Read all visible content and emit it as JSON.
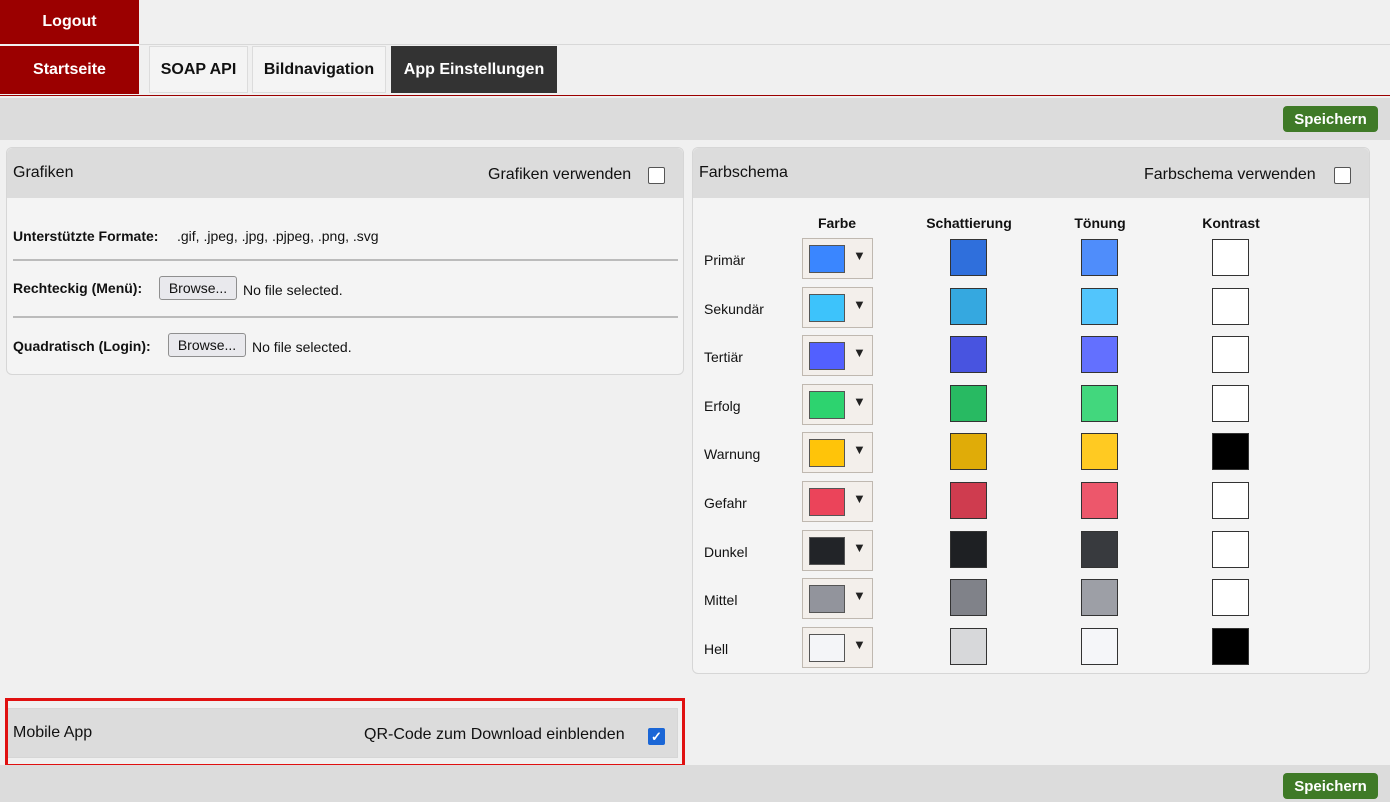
{
  "nav": {
    "logout": "Logout",
    "home": "Startseite",
    "tabs": [
      "SOAP API",
      "Bildnavigation",
      "App Einstellungen"
    ]
  },
  "toolbar": {
    "save_label": "Speichern"
  },
  "graphics": {
    "title": "Grafiken",
    "use_label": "Grafiken verwenden",
    "use_checked": false,
    "formats_label": "Unterstützte Formate:",
    "formats_value": ".gif, .jpeg, .jpg, .pjpeg, .png, .svg",
    "rect_label": "Rechteckig (Menü):",
    "square_label": "Quadratisch (Login):",
    "browse_label": "Browse...",
    "no_file": "No file selected."
  },
  "colors": {
    "title": "Farbschema",
    "use_label": "Farbschema verwenden",
    "use_checked": false,
    "columns": [
      "Farbe",
      "Schattierung",
      "Tönung",
      "Kontrast"
    ],
    "rows": [
      {
        "name": "Primär",
        "base": "#3a86ff",
        "shade": "#2f6fdc",
        "tint": "#4f8dfb",
        "contrast": "#ffffff"
      },
      {
        "name": "Sekundär",
        "base": "#3dc3fb",
        "shade": "#35a8e0",
        "tint": "#52c5fc",
        "contrast": "#ffffff"
      },
      {
        "name": "Tertiär",
        "base": "#5260ff",
        "shade": "#4854e0",
        "tint": "#6370ff",
        "contrast": "#ffffff"
      },
      {
        "name": "Erfolg",
        "base": "#2dd36f",
        "shade": "#28ba62",
        "tint": "#42d77d",
        "contrast": "#ffffff"
      },
      {
        "name": "Warnung",
        "base": "#ffc409",
        "shade": "#e0ac08",
        "tint": "#ffca22",
        "contrast": "#000000"
      },
      {
        "name": "Gefahr",
        "base": "#eb445a",
        "shade": "#cf3c4f",
        "tint": "#ed576b",
        "contrast": "#ffffff"
      },
      {
        "name": "Dunkel",
        "base": "#222428",
        "shade": "#1e2023",
        "tint": "#383a3e",
        "contrast": "#ffffff"
      },
      {
        "name": "Mittel",
        "base": "#92949c",
        "shade": "#808289",
        "tint": "#9d9fa6",
        "contrast": "#ffffff"
      },
      {
        "name": "Hell",
        "base": "#f4f5f8",
        "shade": "#d7d8da",
        "tint": "#f5f6f9",
        "contrast": "#000000"
      }
    ]
  },
  "mobile": {
    "title": "Mobile App",
    "qr_label": "QR-Code zum Download einblenden",
    "qr_checked": true
  }
}
